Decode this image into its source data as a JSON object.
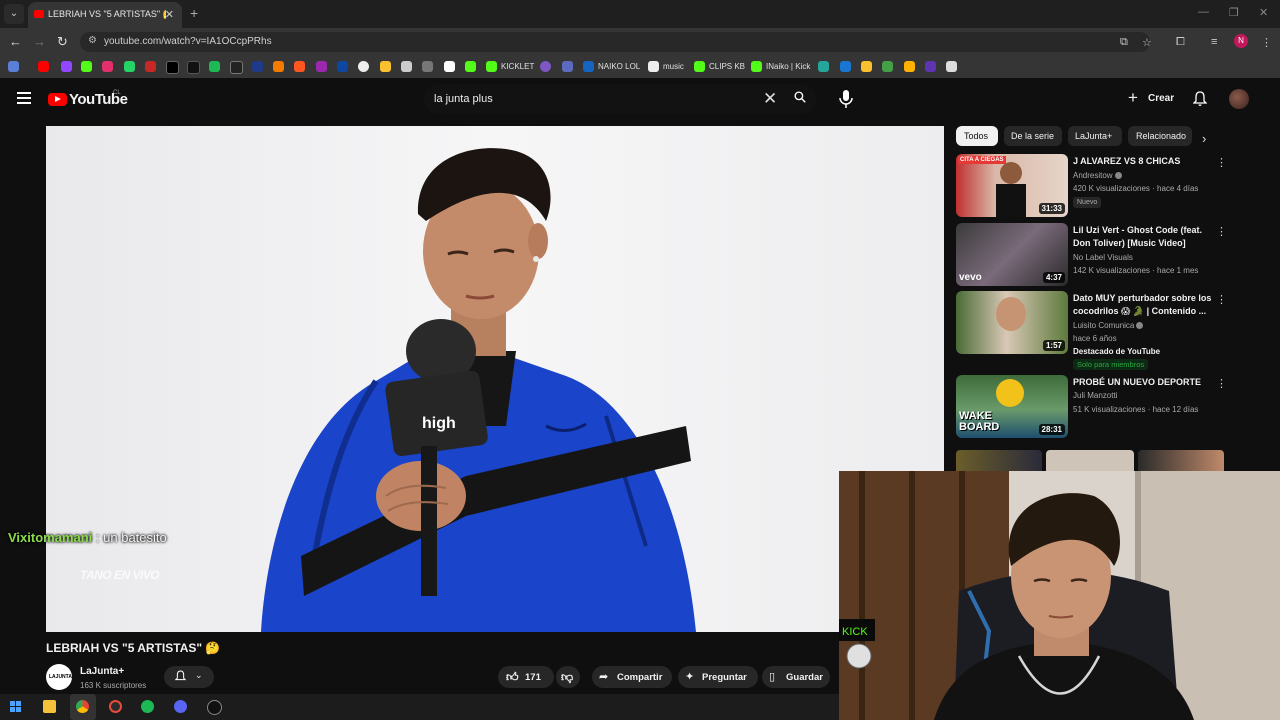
{
  "browser": {
    "tab_title": "LEBRIAH VS \"5 ARTISTAS\" 🤔",
    "url": "youtube.com/watch?v=IA1OCcpPRhs",
    "profile_initial": "N",
    "bookmarks": [
      "KICKLET",
      "NAIKO LOL",
      "music",
      "CLIPS KB",
      "INaiko | Kick"
    ]
  },
  "header": {
    "logo": "YouTube",
    "country": "CL",
    "search_query": "la junta plus",
    "create_label": "Crear"
  },
  "video": {
    "title": "LEBRIAH VS \"5 ARTISTAS\" 🤔",
    "mic_brand": "high",
    "chat_user": "Vixitomamani",
    "chat_message": ": un batesito",
    "watermark": "TANO EN VIVO",
    "channel": {
      "name": "LaJunta+",
      "subscribers": "163 K suscriptores",
      "avatar_text": "LAJUNTA"
    },
    "likes": "171",
    "share_label": "Compartir",
    "ask_label": "Preguntar",
    "save_label": "Guardar"
  },
  "sidebar": {
    "chips": [
      "Todos",
      "De la serie",
      "LaJunta+",
      "Relacionado"
    ],
    "recommendations": [
      {
        "title": "J ALVAREZ VS 8 CHICAS",
        "channel": "Andresitow",
        "meta": "420 K visualizaciones · hace 4 días",
        "badge": "Nuevo",
        "duration": "31:33",
        "thumb_text": "CITA A CIEGAS"
      },
      {
        "title": "Lil Uzi Vert - Ghost Code (feat. Don Toliver) [Music Video]",
        "channel": "No Label Visuals",
        "meta": "142 K visualizaciones · hace 1 mes",
        "duration": "4:37",
        "thumb_text": "vevo"
      },
      {
        "title": "Dato MUY perturbador sobre los cocodrilos 😱 🐊 | Contenido ...",
        "channel": "Luisito Comunica",
        "meta": "hace 6 años",
        "featured": "Destacado de YouTube",
        "members": "Solo para miembros",
        "duration": "1:57"
      },
      {
        "title": "PROBÉ UN NUEVO DEPORTE",
        "channel": "Juli Manzotti",
        "meta": "51 K visualizaciones · hace 12 días",
        "duration": "28:31",
        "thumb_text": "WAKE BOARD"
      }
    ]
  },
  "colors": {
    "background": "#0f0f0f",
    "youtube_red": "#ff0000",
    "chat_user": "#8bdc4b",
    "chip_active": "#f1f1f1"
  }
}
